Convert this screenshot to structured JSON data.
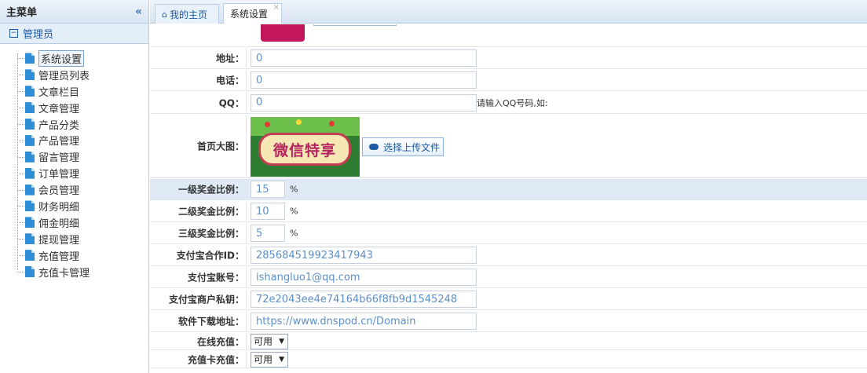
{
  "sidebar": {
    "title": "主菜单",
    "collapse_icon": "«",
    "group_label": "管理员",
    "items": [
      {
        "label": "系统设置",
        "active": true
      },
      {
        "label": "管理员列表"
      },
      {
        "label": "文章栏目"
      },
      {
        "label": "文章管理"
      },
      {
        "label": "产品分类"
      },
      {
        "label": "产品管理"
      },
      {
        "label": "留言管理"
      },
      {
        "label": "订单管理"
      },
      {
        "label": "会员管理"
      },
      {
        "label": "财务明细"
      },
      {
        "label": "佣金明细"
      },
      {
        "label": "提现管理"
      },
      {
        "label": "充值管理"
      },
      {
        "label": "充值卡管理"
      }
    ]
  },
  "tabs": [
    {
      "label": "我的主页",
      "icon": "home-icon"
    },
    {
      "label": "系统设置",
      "active": true,
      "close": "×"
    }
  ],
  "form": {
    "address": {
      "label": "地址：",
      "value": "0"
    },
    "phone": {
      "label": "电话：",
      "value": "0"
    },
    "qq": {
      "label": "QQ：",
      "value": "0",
      "hint": "请输入QQ号码,如:"
    },
    "banner": {
      "label": "首页大图：",
      "image_text": "微信特享",
      "upload_label": "选择上传文件"
    },
    "level1": {
      "label": "一级奖金比例：",
      "value": "15",
      "unit": "%"
    },
    "level2": {
      "label": "二级奖金比例：",
      "value": "10",
      "unit": "%"
    },
    "level3": {
      "label": "三级奖金比例：",
      "value": "5",
      "unit": "%"
    },
    "alipay_partner": {
      "label": "支付宝合作ID：",
      "value": "285684519923417943"
    },
    "alipay_account": {
      "label": "支付宝账号：",
      "value": "ishangluo1@qq.com"
    },
    "alipay_key": {
      "label": "支付宝商户私钥：",
      "value": "72e2043ee4e74164b66f8fb9d1545248"
    },
    "download_url": {
      "label": "软件下载地址：",
      "value": "https://www.dnspod.cn/Domain"
    },
    "online_recharge": {
      "label": "在线充值：",
      "value": "可用"
    },
    "card_recharge": {
      "label": "充值卡充值：",
      "value": "可用"
    }
  },
  "colors": {
    "accent": "#1d5aa3",
    "header_bg": "#d7e4f2",
    "highlight_row": "#dfeaf6",
    "input_text": "#5b8fc7"
  }
}
